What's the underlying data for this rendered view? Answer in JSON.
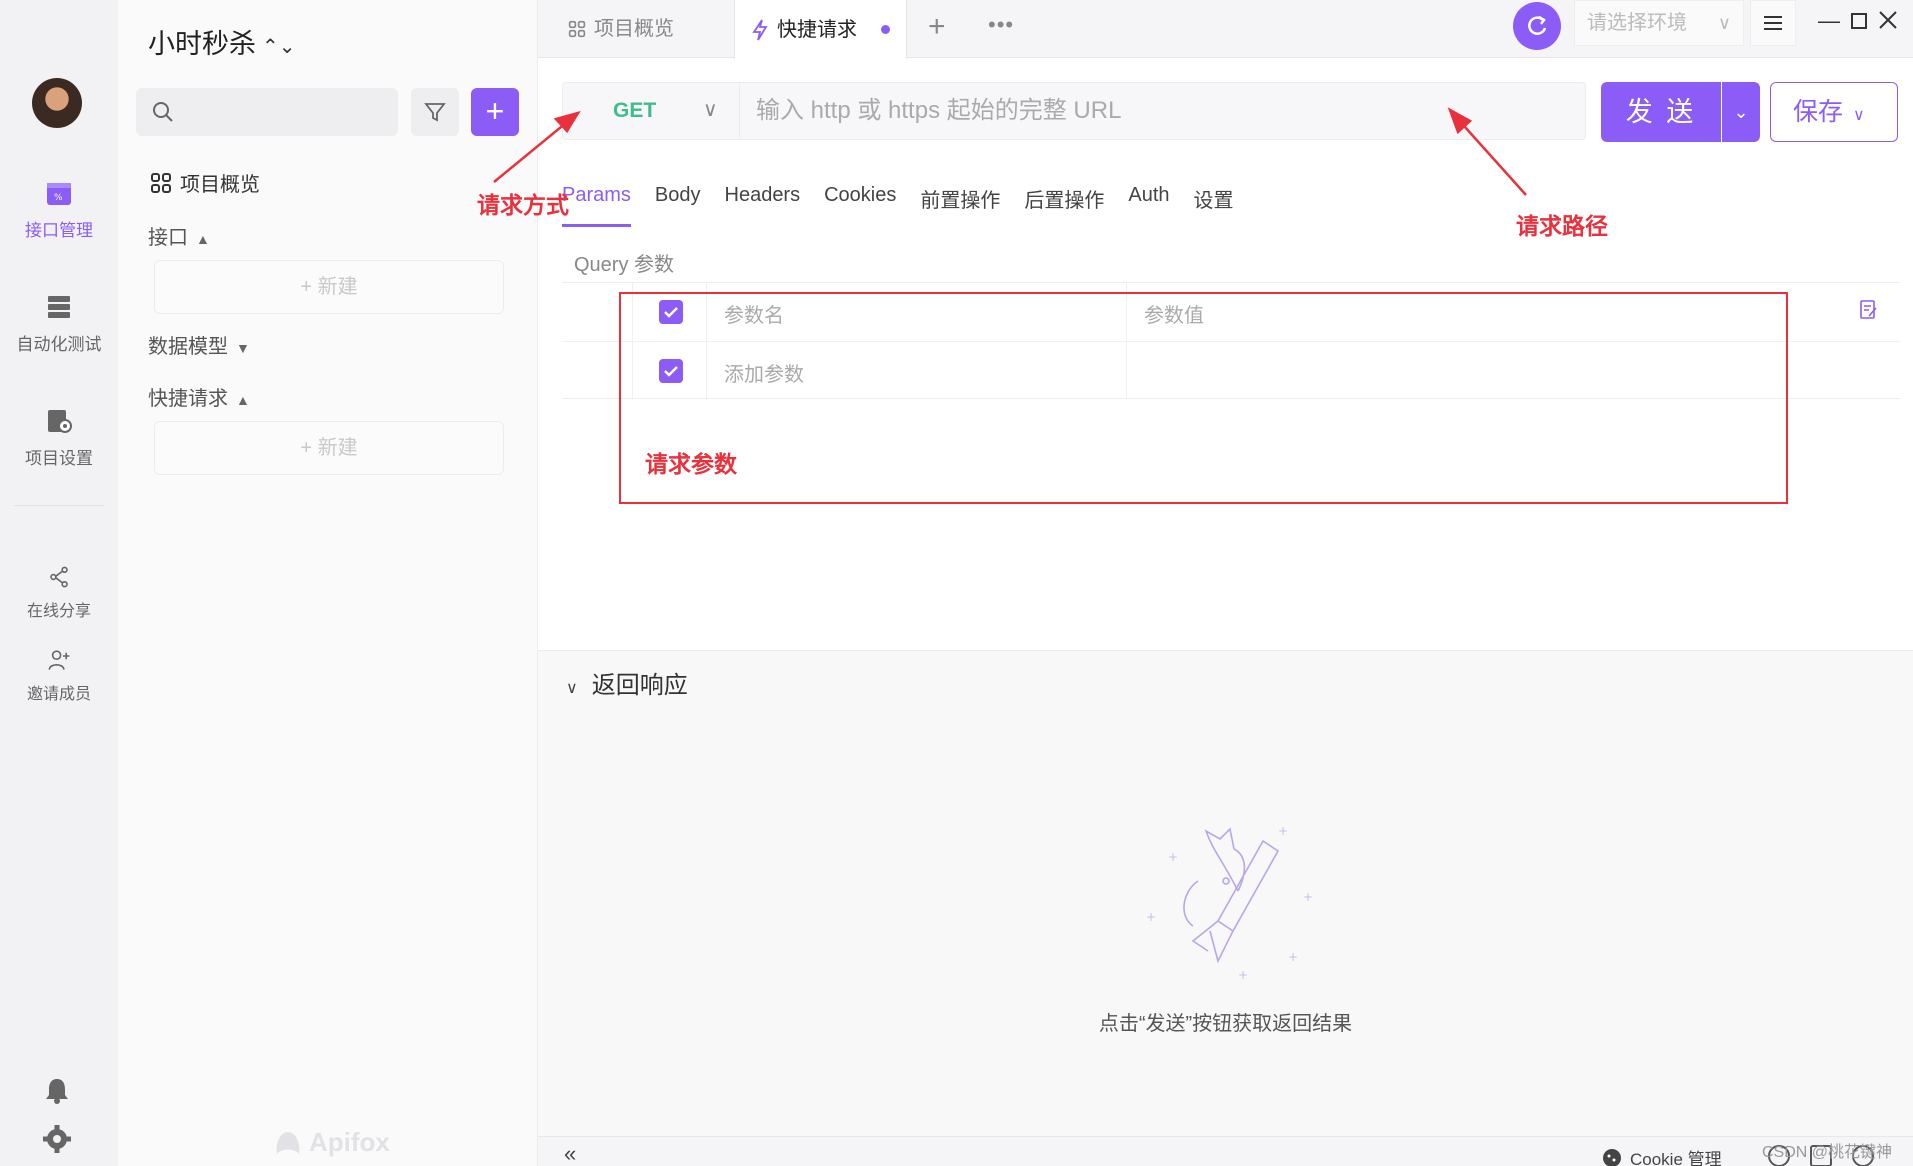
{
  "rail": {
    "items": [
      {
        "label": "接口管理"
      },
      {
        "label": "自动化测试"
      },
      {
        "label": "项目设置"
      },
      {
        "label": "在线分享"
      },
      {
        "label": "邀请成员"
      }
    ]
  },
  "sidebar": {
    "project_title": "小时秒杀",
    "overview": "项目概览",
    "groups": [
      {
        "label": "接口",
        "new_label": "新建"
      },
      {
        "label": "数据模型"
      },
      {
        "label": "快捷请求",
        "new_label": "新建"
      }
    ],
    "brand": "Apifox"
  },
  "tabs": [
    {
      "label": "项目概览"
    },
    {
      "label": "快捷请求"
    }
  ],
  "header": {
    "env_placeholder": "请选择环境"
  },
  "request": {
    "method": "GET",
    "url_placeholder": "输入 http 或 https 起始的完整 URL",
    "send_label": "发 送",
    "save_label": "保存",
    "sub_tabs": [
      "Params",
      "Body",
      "Headers",
      "Cookies",
      "前置操作",
      "后置操作",
      "Auth",
      "设置"
    ],
    "query_label": "Query 参数",
    "params_header": {
      "name": "参数名",
      "value": "参数值"
    },
    "params_add": "添加参数"
  },
  "response": {
    "title": "返回响应",
    "hint": "点击“发送”按钮获取返回结果"
  },
  "statusbar": {
    "cookie": "Cookie 管理"
  },
  "watermark": "CSDN @桃花键神",
  "annotations": {
    "method": "请求方式",
    "path": "请求路径",
    "params": "请求参数"
  },
  "colors": {
    "accent": "#8b5cf6",
    "get_method": "#3ebd8c",
    "annotation": "#e8313c"
  }
}
